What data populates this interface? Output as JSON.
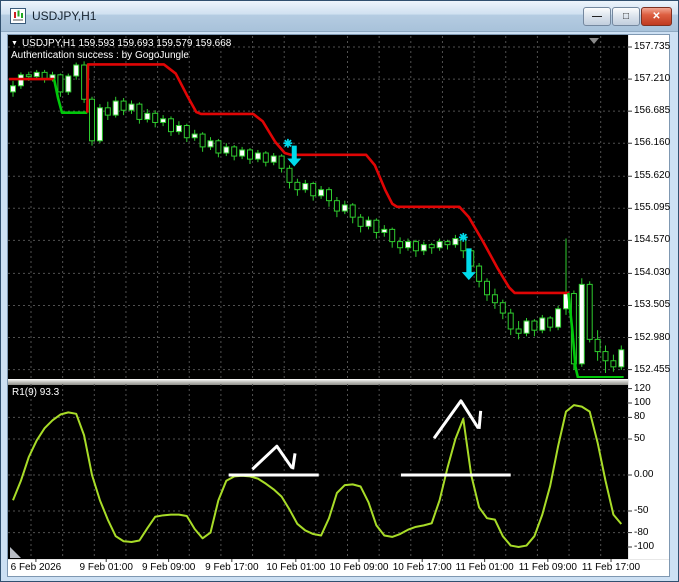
{
  "window": {
    "title": "USDJPY,H1",
    "controls": {
      "minimize_glyph": "—",
      "maximize_glyph": "□",
      "close_glyph": "✕"
    }
  },
  "header": {
    "dropdown_glyph": "▼",
    "symbol_ohlc": "USDJPY,H1 159.593 159.693 159.579 159.668",
    "auth_line": "Authentication success : by GogoJungle"
  },
  "indicator_panel": {
    "label": "R1(9) 93.3"
  },
  "axes": {
    "price_labels": [
      "157.735",
      "157.210",
      "156.685",
      "156.160",
      "155.620",
      "155.095",
      "154.570",
      "154.030",
      "153.505",
      "152.980",
      "152.455"
    ],
    "osc_labels": [
      "120",
      "100",
      "80",
      "50",
      "0.00",
      "-50",
      "-80",
      "-100"
    ],
    "time_labels": [
      {
        "text": "6 Feb 2026",
        "bar": 2.9
      },
      {
        "text": "9 Feb 01:00",
        "bar": 11.8
      },
      {
        "text": "9 Feb 09:00",
        "bar": 19.7
      },
      {
        "text": "9 Feb 17:00",
        "bar": 27.7
      },
      {
        "text": "10 Feb 01:00",
        "bar": 35.8
      },
      {
        "text": "10 Feb 09:00",
        "bar": 43.8
      },
      {
        "text": "10 Feb 17:00",
        "bar": 51.8
      },
      {
        "text": "11 Feb 01:00",
        "bar": 59.7
      },
      {
        "text": "11 Feb 09:00",
        "bar": 67.7
      },
      {
        "text": "11 Feb 17:00",
        "bar": 75.7
      }
    ]
  },
  "colors": {
    "chart_bg": "#000000",
    "grid": "#515151",
    "candle_outline": "#2FCC2F",
    "bull_fill": "#FFFFFF",
    "bear_fill": "#000000",
    "trend_red": "#E00505",
    "trend_green": "#00C80A",
    "oscillator": "#A8DC28",
    "signal_cyan": "#00DCEC",
    "annotation_white": "#FFFFFF",
    "axis_text": "#000000",
    "header_text": "#FFFFFF"
  },
  "chart_data": [
    {
      "type": "candlestick",
      "title": "USDJPY,H1",
      "symbol": "USDJPY",
      "timeframe": "H1",
      "price_range": [
        152.455,
        157.735
      ],
      "ohlc": [
        [
          157.0,
          157.18,
          156.92,
          157.1
        ],
        [
          157.1,
          157.32,
          157.05,
          157.28
        ],
        [
          157.28,
          157.33,
          157.18,
          157.25
        ],
        [
          157.25,
          157.36,
          157.2,
          157.32
        ],
        [
          157.32,
          157.36,
          157.15,
          157.22
        ],
        [
          157.22,
          157.33,
          157.17,
          157.28
        ],
        [
          157.28,
          157.3,
          156.92,
          157.0
        ],
        [
          157.0,
          157.3,
          156.95,
          157.26
        ],
        [
          157.26,
          157.48,
          157.2,
          157.44
        ],
        [
          157.44,
          157.5,
          156.82,
          156.88
        ],
        [
          156.88,
          156.92,
          156.12,
          156.2
        ],
        [
          156.2,
          156.8,
          156.16,
          156.74
        ],
        [
          156.74,
          156.84,
          156.54,
          156.62
        ],
        [
          156.62,
          156.92,
          156.58,
          156.85
        ],
        [
          156.85,
          156.9,
          156.62,
          156.7
        ],
        [
          156.7,
          156.86,
          156.64,
          156.8
        ],
        [
          156.8,
          156.83,
          156.48,
          156.55
        ],
        [
          156.55,
          156.72,
          156.5,
          156.65
        ],
        [
          156.65,
          156.7,
          156.42,
          156.5
        ],
        [
          156.5,
          156.62,
          156.44,
          156.56
        ],
        [
          156.56,
          156.6,
          156.28,
          156.35
        ],
        [
          156.35,
          156.52,
          156.3,
          156.45
        ],
        [
          156.45,
          156.48,
          156.18,
          156.25
        ],
        [
          156.25,
          156.38,
          156.2,
          156.31
        ],
        [
          156.31,
          156.34,
          156.02,
          156.1
        ],
        [
          156.1,
          156.26,
          156.05,
          156.2
        ],
        [
          156.2,
          156.23,
          155.93,
          156.0
        ],
        [
          156.0,
          156.16,
          155.95,
          156.1
        ],
        [
          156.1,
          156.13,
          155.88,
          155.95
        ],
        [
          155.95,
          156.1,
          155.9,
          156.05
        ],
        [
          156.05,
          156.08,
          155.82,
          155.9
        ],
        [
          155.9,
          156.05,
          155.85,
          156.0
        ],
        [
          156.0,
          156.03,
          155.78,
          155.85
        ],
        [
          155.85,
          156.0,
          155.8,
          155.95
        ],
        [
          155.95,
          155.98,
          155.68,
          155.75
        ],
        [
          155.75,
          155.8,
          155.42,
          155.52
        ],
        [
          155.52,
          155.58,
          155.3,
          155.4
        ],
        [
          155.4,
          155.56,
          155.35,
          155.5
        ],
        [
          155.5,
          155.53,
          155.22,
          155.3
        ],
        [
          155.3,
          155.46,
          155.25,
          155.4
        ],
        [
          155.4,
          155.44,
          155.12,
          155.22
        ],
        [
          155.22,
          155.28,
          154.95,
          155.05
        ],
        [
          155.05,
          155.22,
          155.0,
          155.15
        ],
        [
          155.15,
          155.18,
          154.85,
          154.95
        ],
        [
          154.95,
          155.0,
          154.7,
          154.8
        ],
        [
          154.8,
          154.96,
          154.75,
          154.9
        ],
        [
          154.9,
          154.93,
          154.6,
          154.7
        ],
        [
          154.7,
          154.82,
          154.63,
          154.75
        ],
        [
          154.75,
          154.78,
          154.45,
          154.55
        ],
        [
          154.55,
          154.62,
          154.35,
          154.45
        ],
        [
          154.45,
          154.6,
          154.4,
          154.55
        ],
        [
          154.55,
          154.58,
          154.3,
          154.4
        ],
        [
          154.4,
          154.55,
          154.33,
          154.5
        ],
        [
          154.5,
          154.53,
          154.35,
          154.45
        ],
        [
          154.45,
          154.6,
          154.4,
          154.55
        ],
        [
          154.55,
          154.58,
          154.42,
          154.5
        ],
        [
          154.5,
          154.66,
          154.45,
          154.6
        ],
        [
          154.6,
          154.63,
          154.28,
          154.4
        ],
        [
          154.4,
          154.44,
          154.05,
          154.15
        ],
        [
          154.15,
          154.2,
          153.8,
          153.9
        ],
        [
          153.9,
          153.95,
          153.58,
          153.68
        ],
        [
          153.68,
          153.78,
          153.45,
          153.55
        ],
        [
          153.55,
          153.6,
          153.28,
          153.38
        ],
        [
          153.38,
          153.45,
          153.02,
          153.12
        ],
        [
          153.12,
          153.25,
          152.95,
          153.05
        ],
        [
          153.05,
          153.3,
          153.0,
          153.25
        ],
        [
          153.25,
          153.28,
          153.0,
          153.1
        ],
        [
          153.1,
          153.35,
          153.05,
          153.3
        ],
        [
          153.3,
          153.33,
          153.08,
          153.15
        ],
        [
          153.15,
          153.5,
          153.1,
          153.45
        ],
        [
          153.45,
          154.6,
          153.35,
          153.7
        ],
        [
          153.7,
          153.75,
          152.45,
          152.55
        ],
        [
          152.55,
          153.95,
          152.5,
          153.85
        ],
        [
          153.85,
          153.9,
          152.9,
          152.95
        ],
        [
          152.95,
          153.1,
          152.6,
          152.75
        ],
        [
          152.75,
          152.85,
          152.4,
          152.6
        ],
        [
          152.6,
          152.7,
          152.42,
          152.5
        ],
        [
          152.5,
          152.85,
          152.45,
          152.78
        ]
      ],
      "trend_line_segments": [
        {
          "color": "red",
          "points": [
            [
              -0.5,
              157.21
            ],
            [
              5.2,
              157.21
            ]
          ]
        },
        {
          "color": "green",
          "points": [
            [
              5.2,
              157.21
            ],
            [
              5.7,
              156.9
            ],
            [
              6.2,
              156.66
            ],
            [
              9.4,
              156.66
            ]
          ]
        },
        {
          "color": "red",
          "points": [
            [
              9.4,
              156.66
            ],
            [
              9.5,
              157.45
            ],
            [
              19.1,
              157.45
            ],
            [
              20.6,
              157.3
            ],
            [
              22.0,
              156.95
            ],
            [
              23.2,
              156.67
            ],
            [
              23.8,
              156.64
            ],
            [
              30.4,
              156.64
            ],
            [
              31.6,
              156.52
            ],
            [
              33.2,
              156.18
            ],
            [
              34.4,
              156.0
            ],
            [
              35.2,
              155.97
            ],
            [
              44.7,
              155.97
            ],
            [
              45.8,
              155.8
            ],
            [
              47.1,
              155.4
            ],
            [
              48.0,
              155.17
            ],
            [
              48.6,
              155.12
            ],
            [
              56.5,
              155.12
            ],
            [
              57.7,
              154.95
            ],
            [
              59.5,
              154.55
            ],
            [
              61.4,
              154.1
            ],
            [
              62.8,
              153.8
            ],
            [
              63.5,
              153.71
            ],
            [
              70.4,
              153.71
            ]
          ]
        },
        {
          "color": "green",
          "points": [
            [
              70.3,
              153.71
            ],
            [
              70.8,
              153.1
            ],
            [
              71.2,
              152.5
            ],
            [
              71.5,
              152.33
            ],
            [
              77.3,
              152.33
            ]
          ]
        }
      ],
      "signals": [
        {
          "type": "sell-star",
          "bar": 34.8,
          "price": 156.16
        },
        {
          "type": "sell-arrow",
          "bar": 35.6,
          "price_top": 156.12,
          "price_tip": 155.78
        },
        {
          "type": "sell-star",
          "bar": 57.0,
          "price": 154.62
        },
        {
          "type": "sell-arrow",
          "bar": 57.7,
          "price_top": 154.44,
          "price_tip": 153.92
        }
      ]
    },
    {
      "type": "line",
      "name": "R1",
      "period": 9,
      "current_value": 93.3,
      "ylim": [
        -116,
        125
      ],
      "grid_levels": [
        80,
        50,
        0,
        -50,
        -80
      ],
      "values": [
        -35,
        -8,
        25,
        48,
        65,
        76,
        84,
        87,
        85,
        55,
        0,
        -35,
        -62,
        -85,
        -92,
        -93,
        -91,
        -74,
        -58,
        -56,
        -55,
        -55,
        -57,
        -75,
        -88,
        -80,
        -35,
        -8,
        -2,
        -1,
        -2,
        -5,
        -12,
        -20,
        -30,
        -48,
        -68,
        -77,
        -82,
        -84,
        -60,
        -25,
        -14,
        -13,
        -16,
        -38,
        -70,
        -84,
        -86,
        -82,
        -76,
        -72,
        -70,
        -67,
        -35,
        10,
        50,
        78,
        0,
        -45,
        -60,
        -62,
        -85,
        -98,
        -100,
        -98,
        -85,
        -55,
        -15,
        40,
        88,
        97,
        95,
        88,
        45,
        -8,
        -55,
        -68
      ],
      "annotations": {
        "zero_lines": [
          {
            "from": 27.3,
            "to": 38.7,
            "value": 0
          },
          {
            "from": 49.1,
            "to": 63.0,
            "value": 0
          }
        ],
        "chevrons": [
          {
            "points": [
              [
                30.3,
                8
              ],
              [
                33.4,
                40
              ],
              [
                35.3,
                10
              ]
            ],
            "barb": [
              [
                35.7,
                30
              ],
              [
                35.4,
                8
              ]
            ]
          },
          {
            "points": [
              [
                53.3,
                51
              ],
              [
                56.7,
                103
              ],
              [
                58.9,
                65
              ]
            ],
            "barb": [
              [
                59.2,
                89
              ],
              [
                59.0,
                64
              ]
            ]
          }
        ]
      }
    }
  ]
}
